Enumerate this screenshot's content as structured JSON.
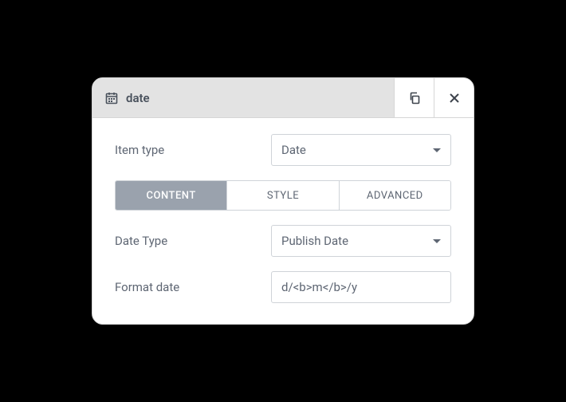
{
  "header": {
    "title": "date"
  },
  "fields": {
    "item_type": {
      "label": "Item type",
      "value": "Date"
    },
    "date_type": {
      "label": "Date Type",
      "value": "Publish Date"
    },
    "format_date": {
      "label": "Format date",
      "value": "d/<b>m</b>/y"
    }
  },
  "tabs": {
    "content": "CONTENT",
    "style": "STYLE",
    "advanced": "ADVANCED"
  }
}
